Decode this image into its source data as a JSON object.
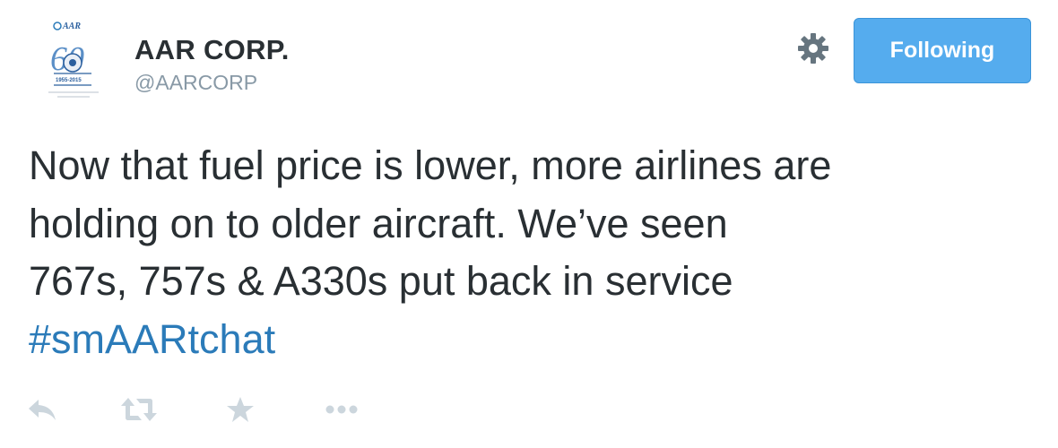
{
  "user": {
    "avatar_logo_text": "AAR",
    "avatar_years": "1955-2015",
    "avatar_anniversary": "60",
    "name": "AAR CORP.",
    "handle": "@AARCORP"
  },
  "header": {
    "settings_icon": "gear-icon",
    "follow_label": "Following"
  },
  "tweet": {
    "lines": [
      "Now that fuel price is lower, more airlines are",
      "holding on to older aircraft. We’ve seen",
      "767s, 757s & A330s put back in service"
    ],
    "hashtag": "#smAARtchat"
  },
  "actions": {
    "icons": [
      "reply-icon",
      "retweet-icon",
      "favorite-icon",
      "more-icon"
    ]
  },
  "colors": {
    "accent": "#55acee",
    "hashtag": "#2b7bb9",
    "text": "#292f33",
    "muted": "#8899a6",
    "action_icon": "#ccd6dd"
  }
}
